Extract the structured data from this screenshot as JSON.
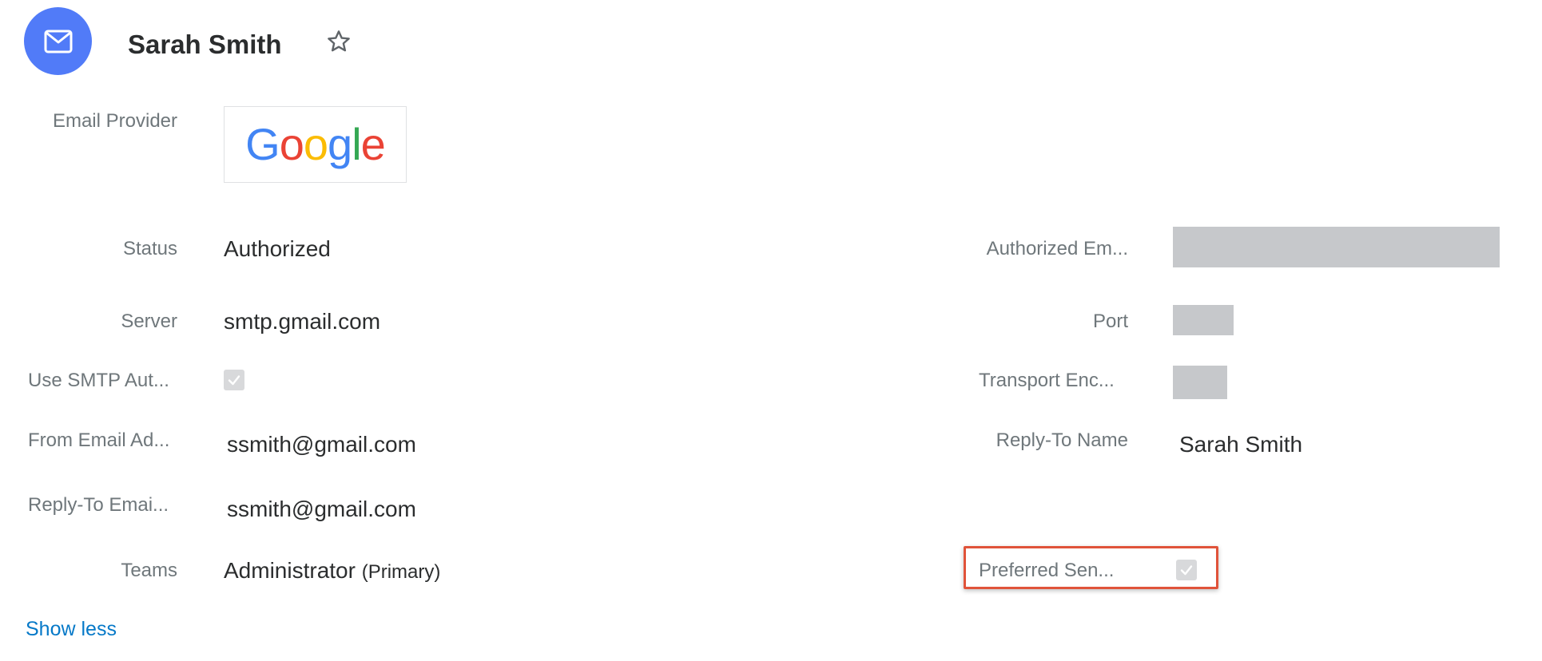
{
  "header": {
    "record_name": "Sarah Smith",
    "module_icon": "envelope-icon",
    "favorite_icon": "star-outline-icon",
    "avatar_color": "#517bf8"
  },
  "fields": {
    "email_provider": {
      "label": "Email Provider",
      "logo_text": "Google"
    },
    "status": {
      "label": "Status",
      "value": "Authorized"
    },
    "authorized_email": {
      "label": "Authorized Em...",
      "value": ""
    },
    "server": {
      "label": "Server",
      "value": "smtp.gmail.com"
    },
    "port": {
      "label": "Port",
      "value": ""
    },
    "use_smtp_auth": {
      "label": "Use SMTP Aut...",
      "checked": true
    },
    "transport_encryption": {
      "label": "Transport Enc...",
      "value": ""
    },
    "from_email": {
      "label": "From Email Ad...",
      "value": "ssmith@gmail.com"
    },
    "reply_to_name": {
      "label": "Reply-To Name",
      "value": "Sarah Smith"
    },
    "reply_to_email": {
      "label": "Reply-To Emai...",
      "value": "ssmith@gmail.com"
    },
    "teams": {
      "label": "Teams",
      "value": "Administrator",
      "suffix": "(Primary)"
    },
    "preferred_sender": {
      "label": "Preferred Sen...",
      "checked": true
    }
  },
  "footer": {
    "show_less": "Show less"
  },
  "colors": {
    "highlight": "#e0533a",
    "link": "#0679c8",
    "redacted": "#c6c8cb"
  }
}
